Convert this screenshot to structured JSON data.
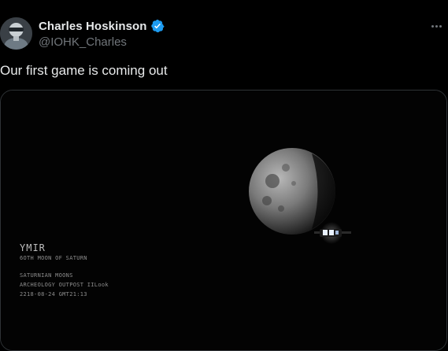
{
  "tweet": {
    "author": {
      "display_name": "Charles Hoskinson",
      "handle": "@IOHK_Charles",
      "verified": true,
      "verified_color": "#1d9bf0",
      "avatar_icon": "profile-avatar"
    },
    "text": "Our first game is coming out",
    "more_icon": "more-options-icon"
  },
  "media": {
    "type": "video-frame",
    "caption": {
      "title": "YMIR",
      "lines": [
        "6OTH MOON OF SATURN",
        "SATURNIAN MOONS",
        "ARCHEOLOGY OUTPOST IILook",
        "2218-08-24 GMT21:13"
      ]
    },
    "objects": [
      "moon",
      "spacecraft"
    ]
  },
  "colors": {
    "background": "#000000",
    "text_primary": "#e7e9ea",
    "text_secondary": "#71767b",
    "border": "#2f3336"
  }
}
